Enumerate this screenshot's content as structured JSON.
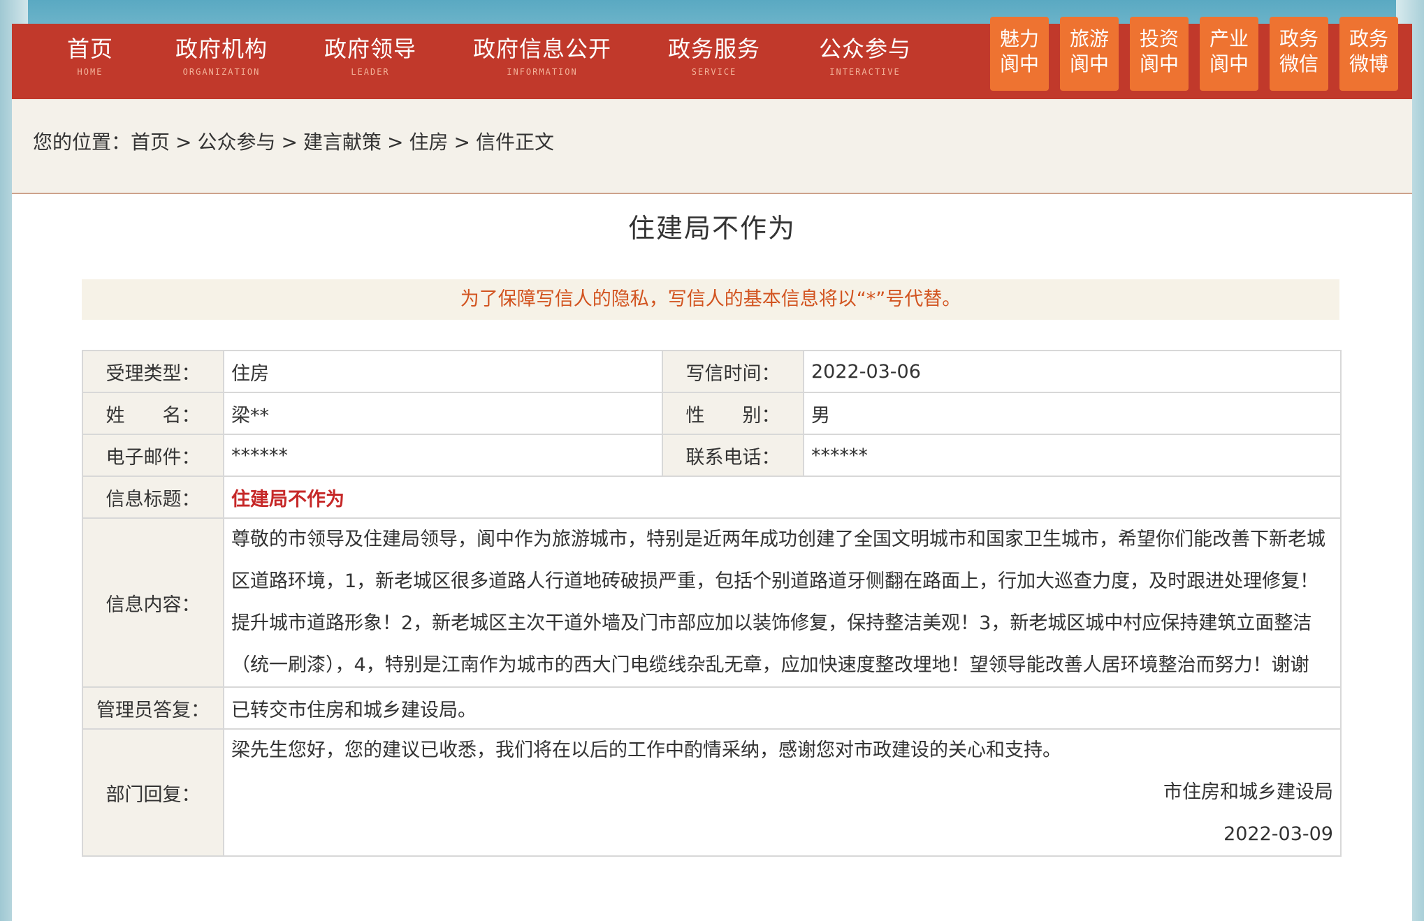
{
  "nav": {
    "items": [
      {
        "zh": "首页",
        "en": "HOME"
      },
      {
        "zh": "政府机构",
        "en": "ORGANIZATION"
      },
      {
        "zh": "政府领导",
        "en": "LEADER"
      },
      {
        "zh": "政府信息公开",
        "en": "INFORMATION"
      },
      {
        "zh": "政务服务",
        "en": "SERVICE"
      },
      {
        "zh": "公众参与",
        "en": "INTERACTIVE"
      }
    ],
    "side_buttons": [
      {
        "l1": "魅力",
        "l2": "阆中"
      },
      {
        "l1": "旅游",
        "l2": "阆中"
      },
      {
        "l1": "投资",
        "l2": "阆中"
      },
      {
        "l1": "产业",
        "l2": "阆中"
      },
      {
        "l1": "政务",
        "l2": "微信"
      },
      {
        "l1": "政务",
        "l2": "微博"
      }
    ]
  },
  "breadcrumb": {
    "prefix": "您的位置：",
    "items": [
      "首页",
      "公众参与",
      "建言献策",
      "住房",
      "信件正文"
    ],
    "sep": ">"
  },
  "page_title": "住建局不作为",
  "privacy_notice": "为了保障写信人的隐私，写信人的基本信息将以“*”号代替。",
  "letter": {
    "type_label": "受理类型：",
    "type_value": "住房",
    "time_label": "写信时间：",
    "time_value": "2022-03-06",
    "name_label": "姓　　名：",
    "name_value": "梁**",
    "gender_label": "性　　别：",
    "gender_value": "男",
    "email_label": "电子邮件：",
    "email_value": "******",
    "phone_label": "联系电话：",
    "phone_value": "******",
    "subject_label": "信息标题：",
    "subject_value": "住建局不作为",
    "content_label": "信息内容：",
    "content_value": "尊敬的市领导及住建局领导，阆中作为旅游城市，特别是近两年成功创建了全国文明城市和国家卫生城市，希望你们能改善下新老城区道路环境，1，新老城区很多道路人行道地砖破损严重，包括个别道路道牙侧翻在路面上，行加大巡查力度，及时跟进处理修复！提升城市道路形象！2，新老城区主次干道外墙及门市部应加以装饰修复，保持整洁美观！3，新老城区城中村应保持建筑立面整洁（统一刷漆），4，特别是江南作为城市的西大门电缆线杂乱无章，应加快速度整改埋地！望领导能改善人居环境整治而努力！谢谢",
    "admin_reply_label": "管理员答复：",
    "admin_reply_value": "已转交市住房和城乡建设局。",
    "dept_reply_label": "部门回复：",
    "dept_reply_text": "梁先生您好，您的建议已收悉，我们将在以后的工作中酌情采纳，感谢您对市政建设的关心和支持。",
    "dept_reply_signature": "市住房和城乡建设局",
    "dept_reply_date": "2022-03-09"
  }
}
